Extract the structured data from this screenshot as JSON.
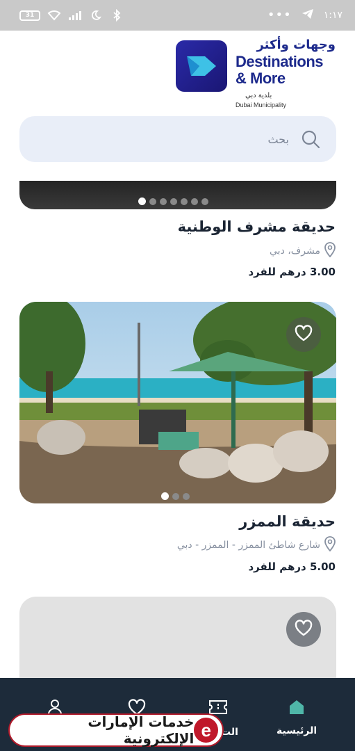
{
  "status_bar": {
    "battery": "31",
    "time": "١:١٧"
  },
  "logo": {
    "arabic": "وجهات وأكثر",
    "english_line1": "Destinations",
    "english_line2": "& More",
    "dm_arabic": "بلدية دبي",
    "dm_english": "Dubai Municipality"
  },
  "search": {
    "placeholder": "بحث"
  },
  "cards": [
    {
      "title": "حديقة مشرف الوطنية",
      "location": "مشرف، دبي",
      "price": "3.00 درهم للفرد",
      "dots": 7,
      "active_dot": 0
    },
    {
      "title": "حديقة الممزر",
      "location": "شارع شاطئ الممزر - الممزر - دبي",
      "price": "5.00 درهم للفرد",
      "dots": 3,
      "active_dot": 0
    }
  ],
  "bottom_nav": {
    "home_label": "الرئيسية",
    "partial_label": "الت"
  },
  "watermark": {
    "text": "خدمات الإمارات الإلكترونية",
    "logo_letter": "e"
  },
  "colors": {
    "accent": "#1d2a8c",
    "nav_bg": "#1d2b3a",
    "search_bg": "#e9eef8",
    "home_icon": "#4fb6a8"
  }
}
